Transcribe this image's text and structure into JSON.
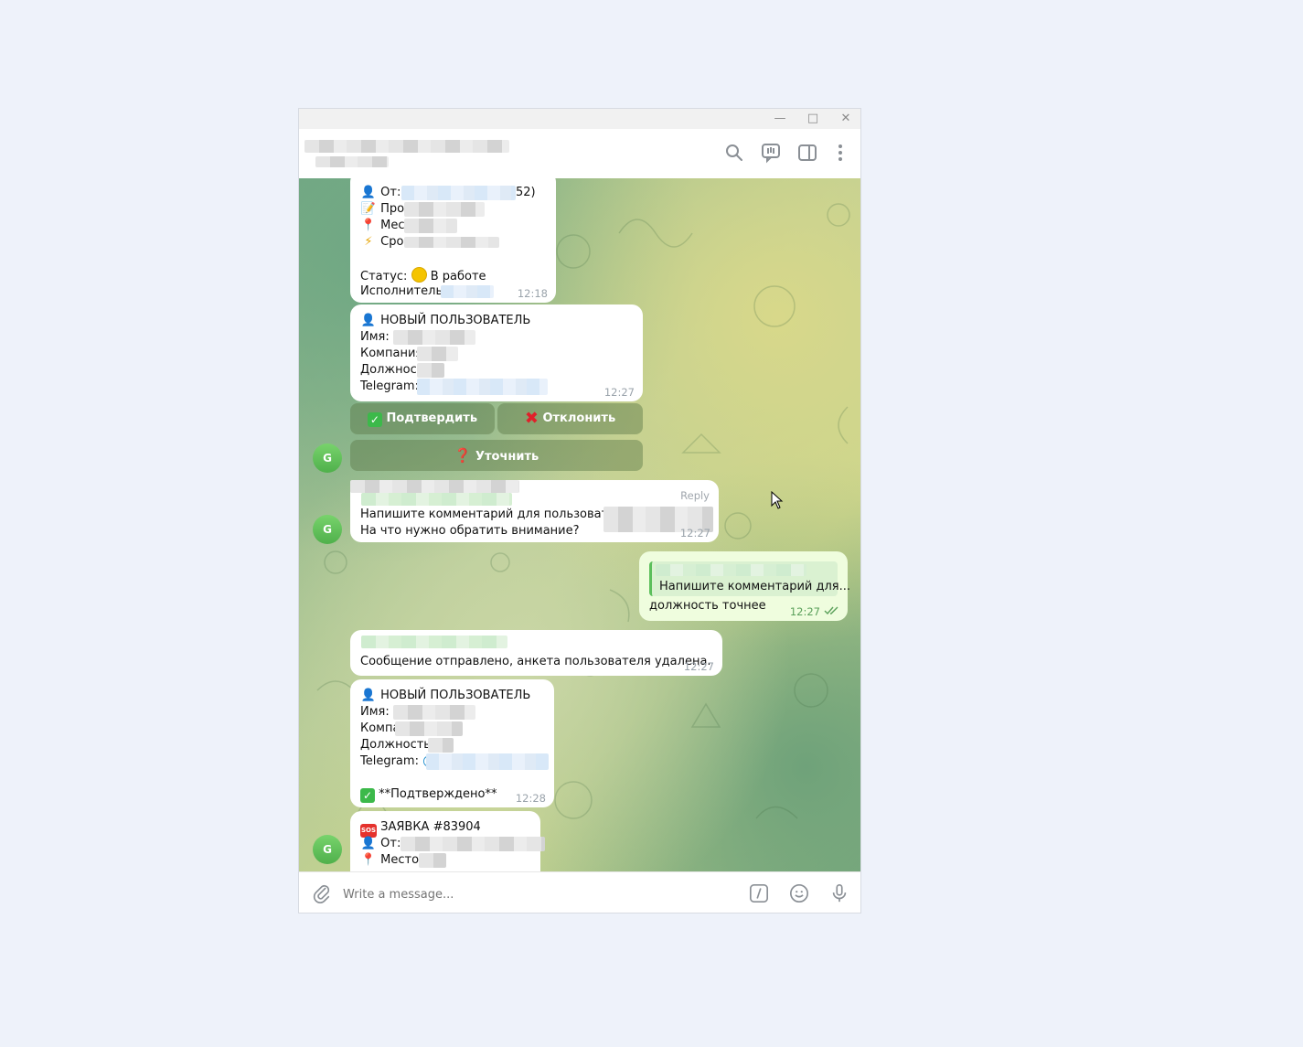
{
  "window": {
    "minimize_icon": "minimize-icon",
    "maximize_icon": "maximize-icon",
    "close_icon": "close-icon"
  },
  "header": {
    "icons": [
      "search-icon",
      "topics-icon",
      "sidebar-toggle-icon",
      "more-vert-icon"
    ]
  },
  "messages": {
    "m1": {
      "line_from": "От:",
      "line_from_tail": "52)",
      "line_problem": "Про",
      "line_place": "Мес",
      "line_deadline": "Сро",
      "status_label": "Статус:",
      "status_value": "В работе",
      "executor_label": "Исполнитель:",
      "time": "12:18"
    },
    "m2": {
      "title": "НОВЫЙ ПОЛЬЗОВАТЕЛЬ",
      "name_label": "Имя: ",
      "company_label": "Компания",
      "position_label": "Должност",
      "telegram_label": "Telegram:",
      "time": "12:27",
      "buttons": {
        "confirm": "Подтвердить",
        "reject": "Отклонить",
        "clarify": "Уточнить"
      }
    },
    "m3": {
      "reply_label": "Reply",
      "line1": "Напишите комментарий для пользователя",
      "line2": "На что нужно обратить внимание?",
      "time": "12:27"
    },
    "m4": {
      "quote_text": "Напишите комментарий для...",
      "text": "должность точнее",
      "time": "12:27"
    },
    "m5": {
      "text": "Сообщение отправлено, анкета пользователя удалена.",
      "time": "12:27"
    },
    "m6": {
      "title": "НОВЫЙ ПОЛЬЗОВАТЕЛЬ",
      "name_label": "Имя: ",
      "company_label": "Компа",
      "position_label": "Должность:",
      "telegram_label": "Telegram:",
      "telegram_at": "@",
      "confirmed": "**Подтверждено**",
      "time": "12:28"
    },
    "m7": {
      "title": "ЗАЯВКА #83904",
      "from_label": "От:",
      "place_label": "Место"
    }
  },
  "avatar_letter": "G",
  "composer": {
    "placeholder": "Write a message..."
  },
  "colors": {
    "accent_green": "#5cbf5c",
    "outgoing_bubble": "#effdde",
    "link_blue": "#168acd"
  }
}
